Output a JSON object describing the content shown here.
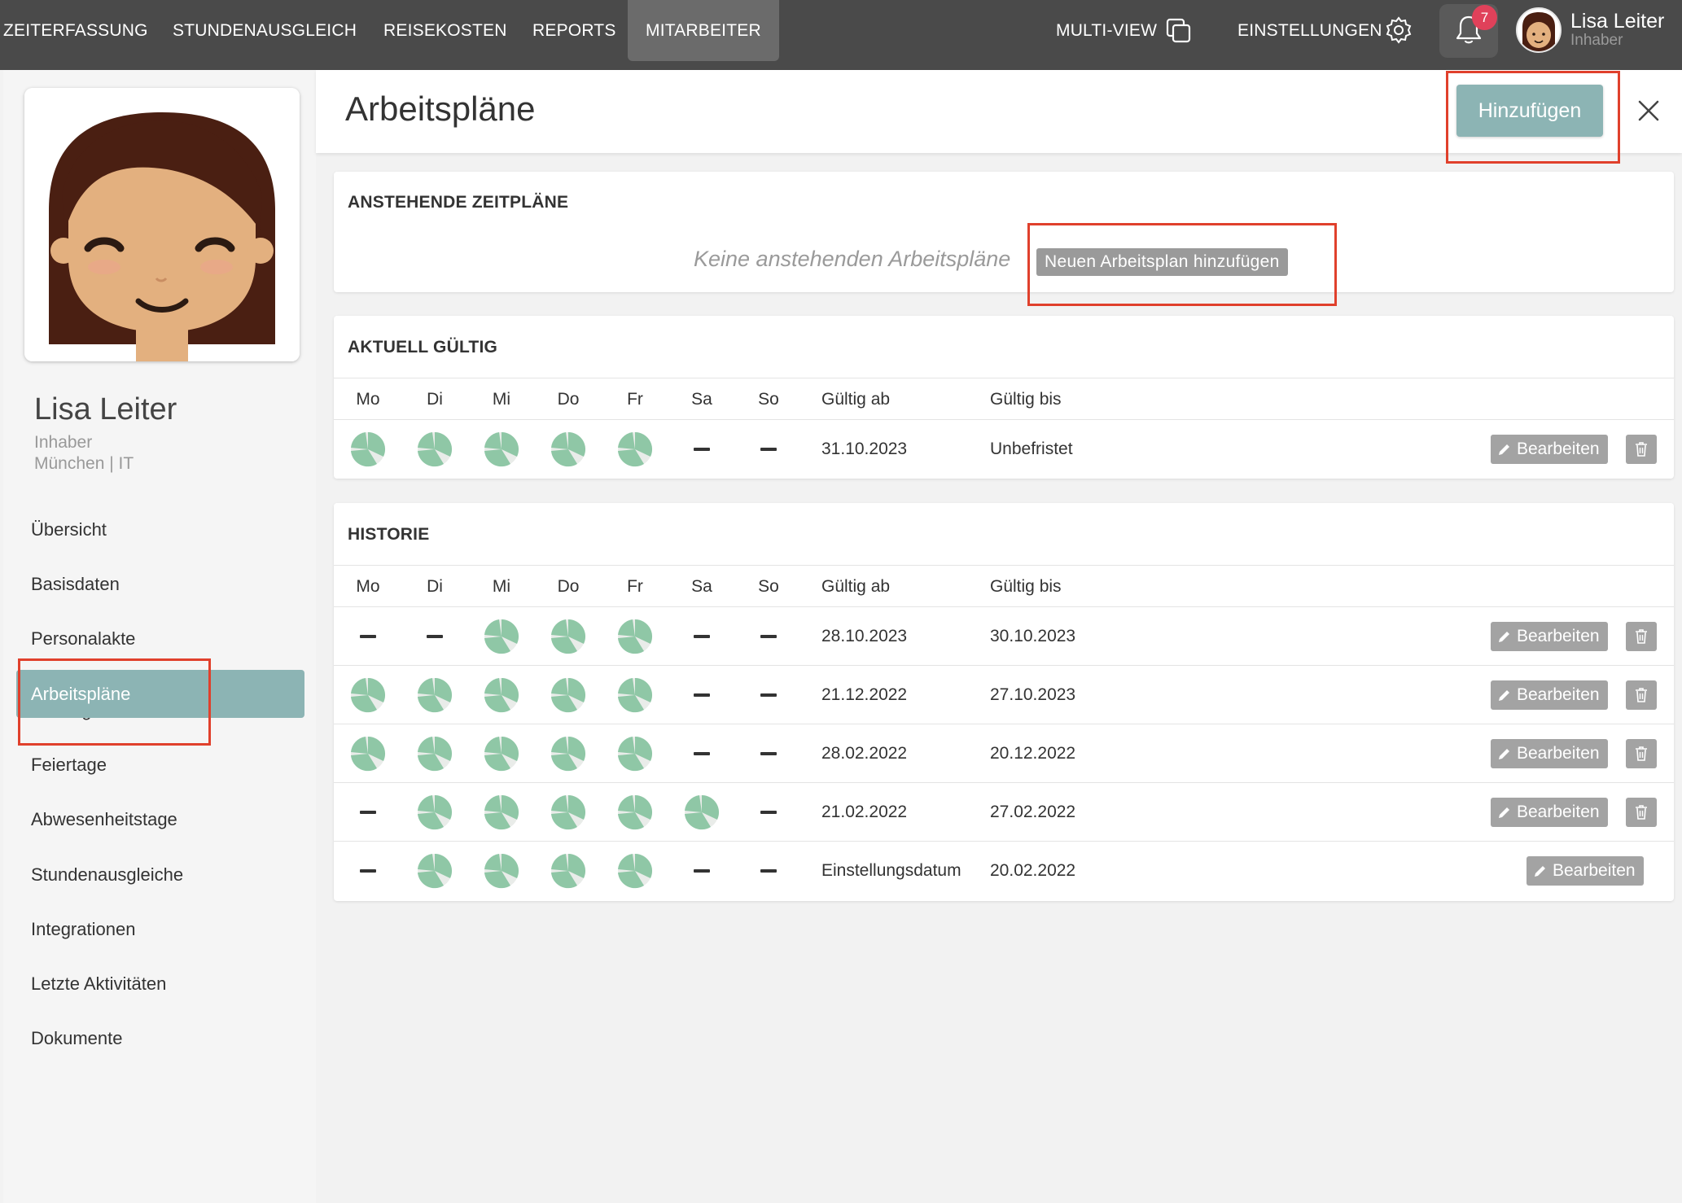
{
  "nav": {
    "items": [
      "ZEITERFASSUNG",
      "STUNDENAUSGLEICH",
      "REISEKOSTEN",
      "REPORTS",
      "MITARBEITER"
    ],
    "active": "MITARBEITER",
    "multiview": "MULTI-VIEW",
    "settings": "EINSTELLUNGEN",
    "notifications_count": "7",
    "user_name": "Lisa Leiter",
    "user_role": "Inhaber"
  },
  "profile": {
    "name": "Lisa Leiter",
    "role": "Inhaber",
    "dept": "München | IT"
  },
  "sidebar": {
    "items": [
      "Übersicht",
      "Basisdaten",
      "Personalakte",
      "Arbeitspläne",
      "Kontingente",
      "Feiertage",
      "Abwesenheitstage",
      "Stundenausgleiche",
      "Integrationen",
      "Letzte Aktivitäten",
      "Dokumente"
    ],
    "active": "Arbeitspläne"
  },
  "page": {
    "title": "Arbeitspläne",
    "add_button": "Hinzufügen"
  },
  "pending": {
    "title": "ANSTEHENDE ZEITPLÄNE",
    "empty_text": "Keine anstehenden Arbeitspläne",
    "add_new_button": "Neuen Arbeitsplan hinzufügen"
  },
  "table_headers": {
    "days": [
      "Mo",
      "Di",
      "Mi",
      "Do",
      "Fr",
      "Sa",
      "So"
    ],
    "valid_from": "Gültig ab",
    "valid_to": "Gültig bis"
  },
  "current": {
    "title": "AKTUELL GÜLTIG",
    "rows": [
      {
        "days": [
          true,
          true,
          true,
          true,
          true,
          false,
          false
        ],
        "from": "31.10.2023",
        "to": "Unbefristet",
        "deletable": true
      }
    ]
  },
  "history": {
    "title": "HISTORIE",
    "rows": [
      {
        "days": [
          false,
          false,
          true,
          true,
          true,
          false,
          false
        ],
        "from": "28.10.2023",
        "to": "30.10.2023",
        "deletable": true
      },
      {
        "days": [
          true,
          true,
          true,
          true,
          true,
          false,
          false
        ],
        "from": "21.12.2022",
        "to": "27.10.2023",
        "deletable": true
      },
      {
        "days": [
          true,
          true,
          true,
          true,
          true,
          false,
          false
        ],
        "from": "28.02.2022",
        "to": "20.12.2022",
        "deletable": true
      },
      {
        "days": [
          false,
          true,
          true,
          true,
          true,
          true,
          false
        ],
        "from": "21.02.2022",
        "to": "27.02.2022",
        "deletable": true
      },
      {
        "days": [
          false,
          true,
          true,
          true,
          true,
          false,
          false
        ],
        "from": "Einstellungsdatum",
        "to": "20.02.2022",
        "deletable": false
      }
    ]
  },
  "row_actions": {
    "edit_label": "Bearbeiten"
  },
  "colors": {
    "topbar": "#4a4a4a",
    "accent": "#8cb4b4",
    "workday_pie": "#8fc7a6",
    "highlight": "#e0402c"
  }
}
